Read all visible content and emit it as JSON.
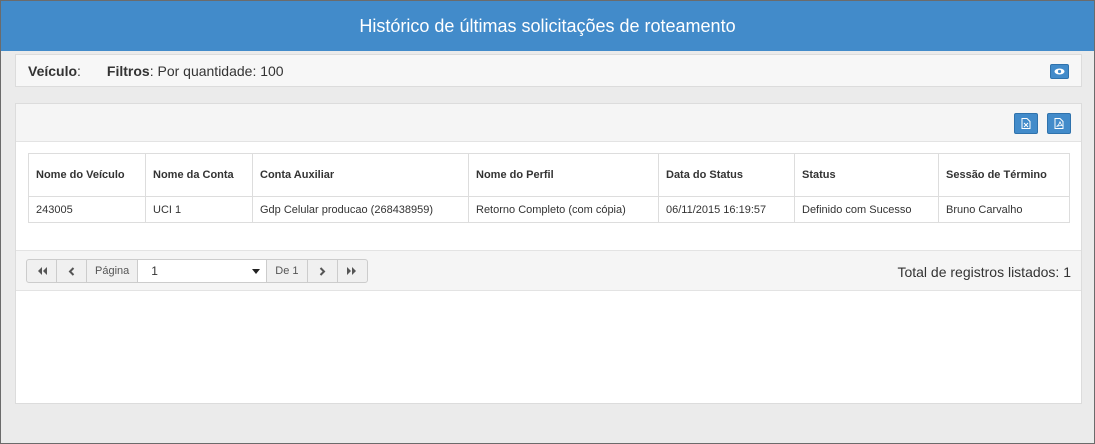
{
  "header": {
    "title": "Histórico de últimas solicitações de roteamento"
  },
  "filter_bar": {
    "veiculo_label": "Veículo",
    "veiculo_colon": ":",
    "filtros_label": "Filtros",
    "filtros_value": ": Por quantidade: 100",
    "eye_icon": "eye-icon"
  },
  "toolbar": {
    "export_excel_icon": "excel-file-icon",
    "export_pdf_icon": "pdf-file-icon"
  },
  "table": {
    "columns": [
      "Nome do Veículo",
      "Nome da Conta",
      "Conta Auxiliar",
      "Nome do Perfil",
      "Data do Status",
      "Status",
      "Sessão de Término"
    ],
    "rows": [
      [
        "243005",
        "UCI 1",
        "Gdp Celular producao (268438959)",
        "Retorno Completo (com cópia)",
        "06/11/2015 16:19:57",
        "Definido com Sucesso",
        "Bruno Carvalho"
      ]
    ]
  },
  "pager": {
    "page_label": "Página",
    "page_value": "1",
    "of_label": "De 1",
    "total_text": "Total de registros listados: 1"
  },
  "colors": {
    "header_bg": "#428bca",
    "button_bg": "#428bca"
  }
}
